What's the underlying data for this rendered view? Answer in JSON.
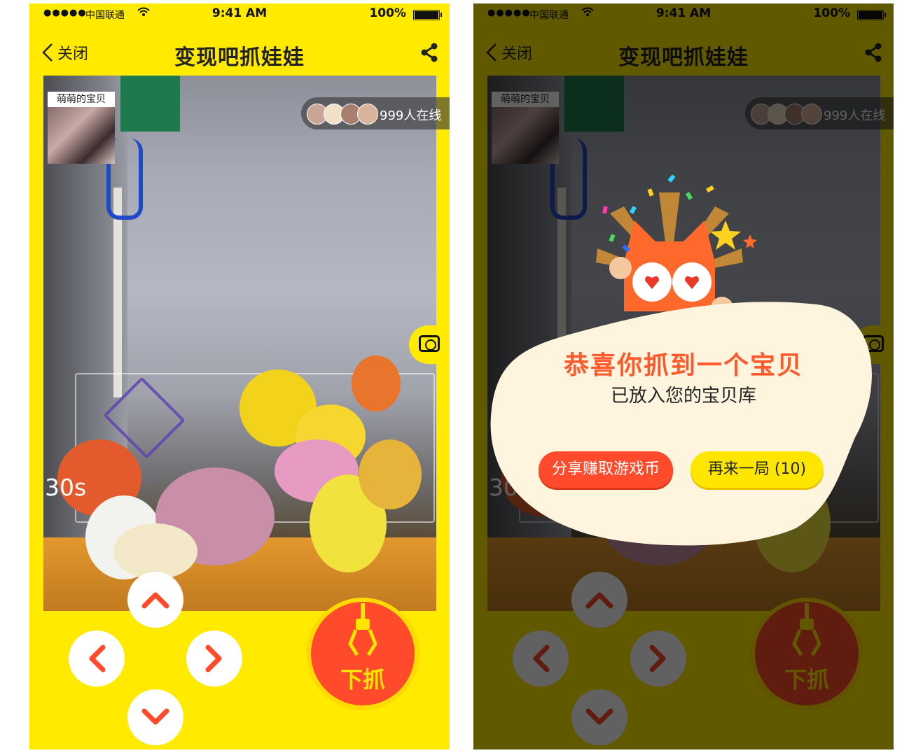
{
  "status": {
    "signal": "●●●●●",
    "carrier": "中国联通",
    "time": "9:41 AM",
    "battery": "100%"
  },
  "nav": {
    "back_label": "关闭",
    "title": "变现吧抓娃娃"
  },
  "player": {
    "name": "萌萌的宝贝"
  },
  "online": {
    "count_text": "999人在线"
  },
  "game": {
    "timer": "30s",
    "grab_label": "下抓"
  },
  "controls": {
    "up": "up-arrow-icon",
    "left": "left-arrow-icon",
    "right": "right-arrow-icon",
    "down": "down-arrow-icon"
  },
  "popup": {
    "title": "恭喜你抓到一个宝贝",
    "subtitle": "已放入您的宝贝库",
    "share_button": "分享赚取游戏币",
    "again_button": "再来一局 (10)"
  },
  "colors": {
    "background": "#FFEA00",
    "accent": "#FF4B2B",
    "accent_text": "#FFE400",
    "popup_bg": "#FFF4DE"
  }
}
